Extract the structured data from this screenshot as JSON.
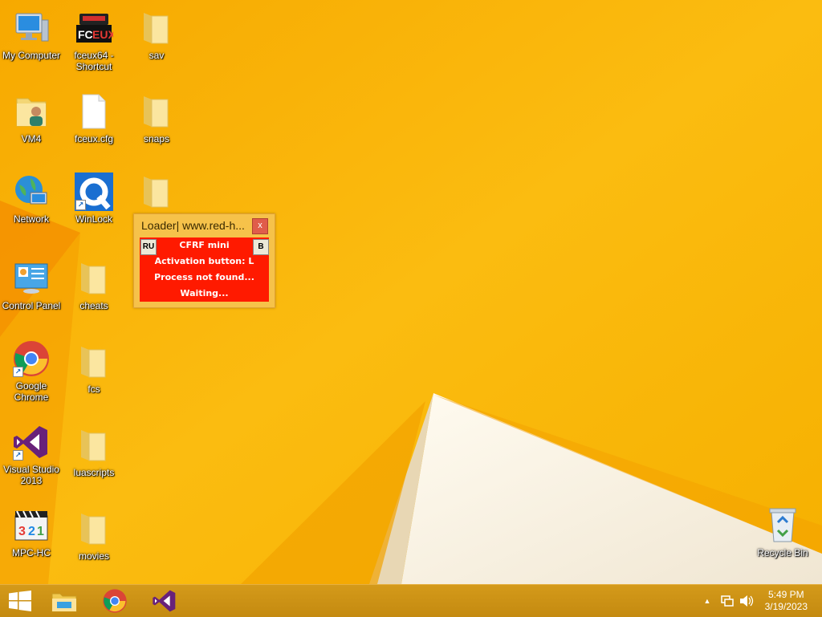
{
  "desktop_icons": {
    "my_computer": "My Computer",
    "fceux": "fceux64 - Shortcut",
    "sav": "sav",
    "vm4": "VM4",
    "fceux_cfg": "fceux.cfg",
    "snaps": "snaps",
    "network": "Network",
    "winlock": "WinLock",
    "control_panel": "Control Panel",
    "cheats": "cheats",
    "chrome": "Google Chrome",
    "fcs": "fcs",
    "visual_studio": "Visual Studio 2013",
    "luascripts": "luascripts",
    "mpc": "MPC-HC",
    "movies": "movies",
    "recycle_bin": "Recycle Bin"
  },
  "loader": {
    "title": "Loader| www.red-h...",
    "close_label": "x",
    "lang_button": "RU",
    "b_button": "B",
    "lines": [
      "CFRF mini",
      "Activation button: L",
      "Process not found...",
      "Waiting..."
    ]
  },
  "taskbar": {
    "time": "5:49 PM",
    "date": "3/19/2023",
    "tray_expand": "▲"
  },
  "colors": {
    "wallpaper": "#f8b000",
    "taskbar": "#c48a10",
    "loader_panel": "#ff1a00"
  }
}
